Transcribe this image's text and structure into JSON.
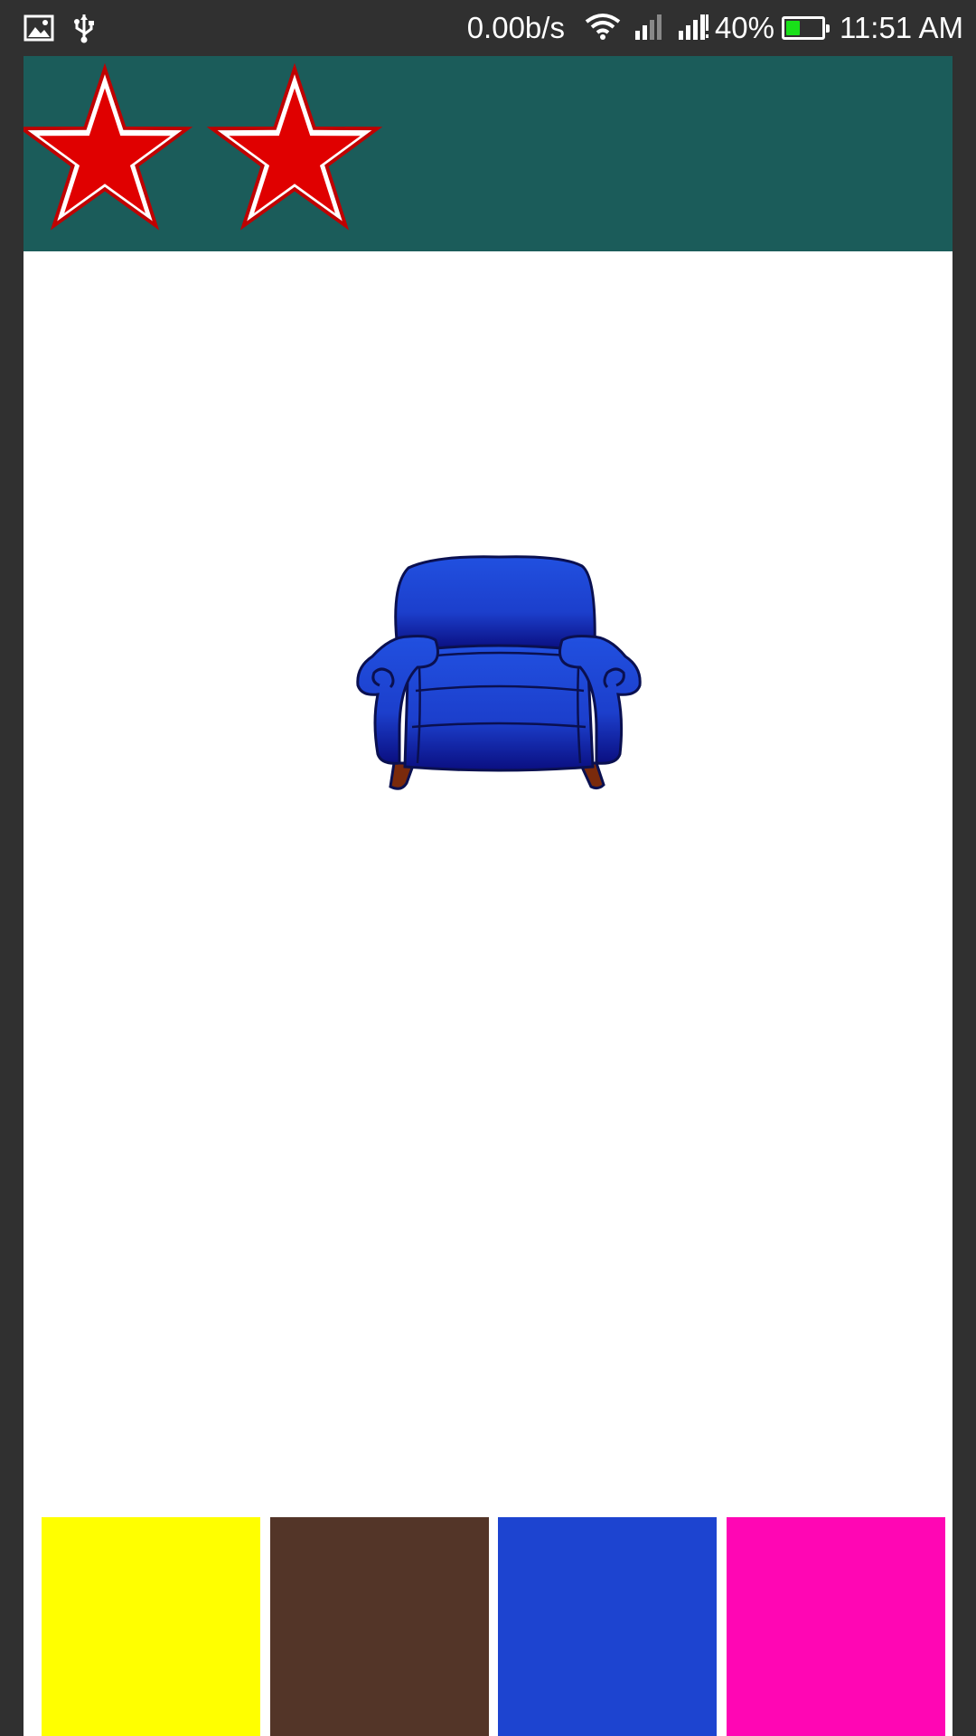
{
  "status_bar": {
    "icons_left": [
      "image-icon",
      "usb-icon"
    ],
    "network_speed": "0.00b/s",
    "icons_right": [
      "wifi-icon",
      "signal-1-icon",
      "signal-2-icon"
    ],
    "battery_percent": "40%",
    "battery_level": 0.4,
    "battery_color": "#19e019",
    "time": "11:51 AM"
  },
  "header": {
    "background": "#1b5c5a",
    "stars_earned": 2,
    "star_color": "#e00000"
  },
  "main": {
    "image": "armchair",
    "image_color": "#1d44d0"
  },
  "color_options": [
    {
      "name": "yellow",
      "color": "#ffff00"
    },
    {
      "name": "brown",
      "color": "#533528"
    },
    {
      "name": "blue",
      "color": "#1d44d0"
    },
    {
      "name": "pink",
      "color": "#ff06b4"
    }
  ]
}
